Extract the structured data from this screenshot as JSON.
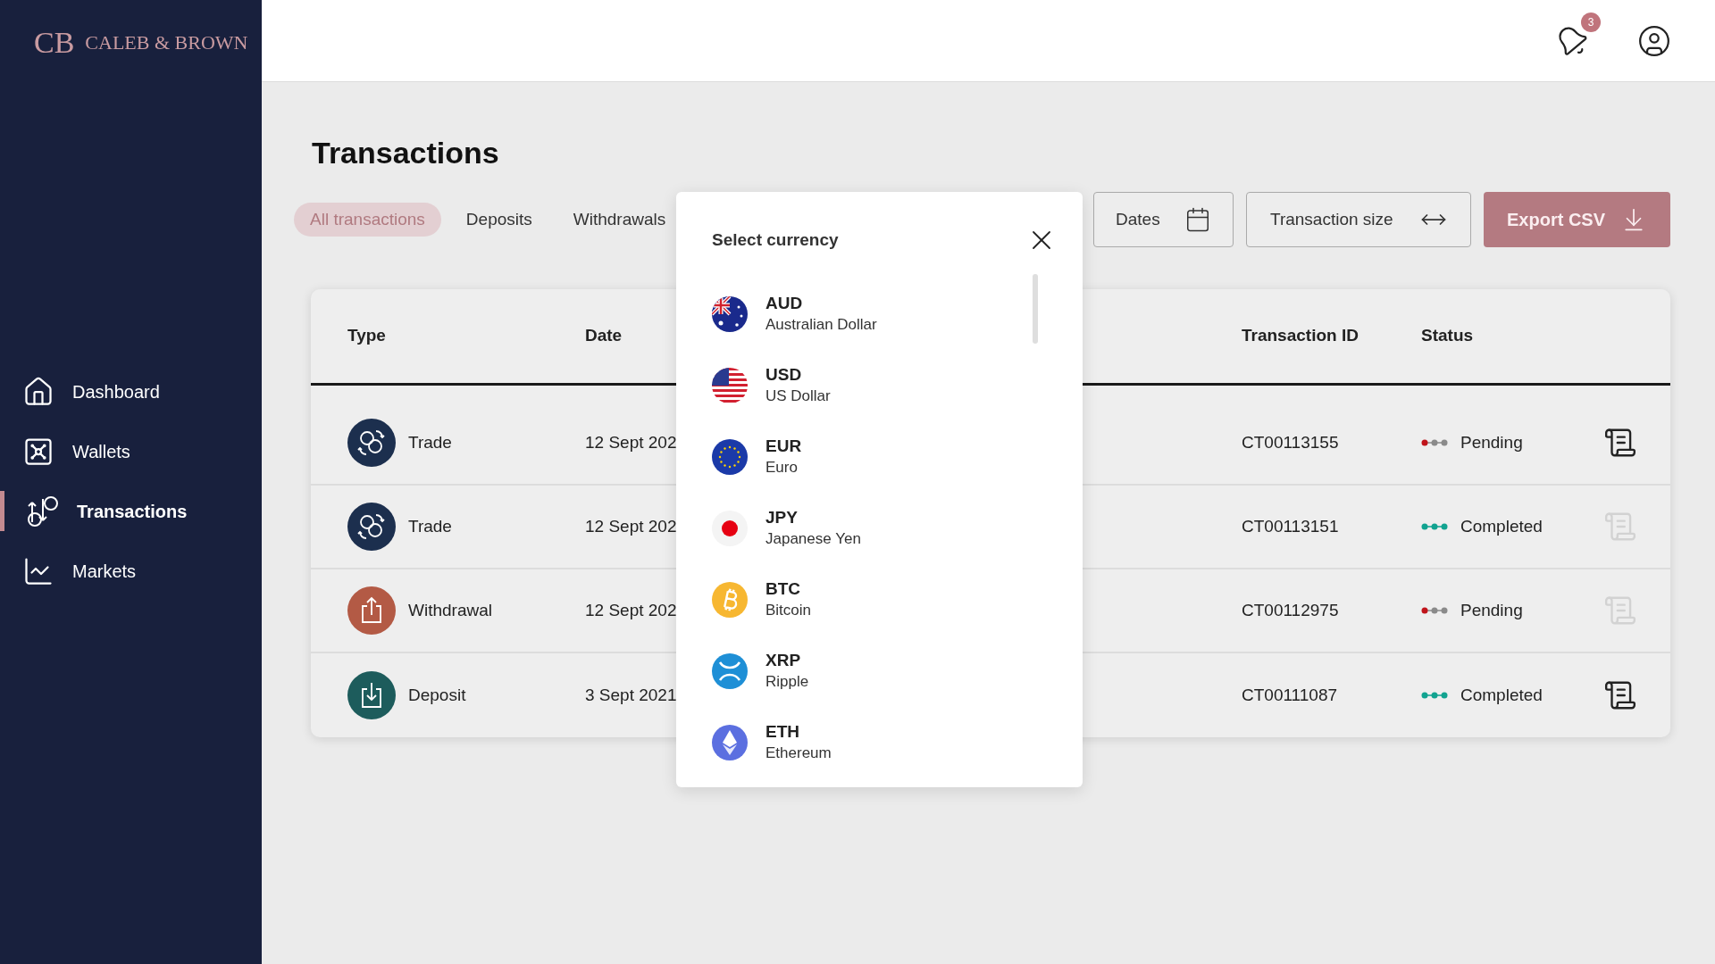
{
  "brand": {
    "monogram": "CB",
    "name": "CALEB & BROWN"
  },
  "sidebar": {
    "items": [
      {
        "label": "Dashboard",
        "selected": false
      },
      {
        "label": "Wallets",
        "selected": false
      },
      {
        "label": "Transactions",
        "selected": true
      },
      {
        "label": "Markets",
        "selected": false
      }
    ]
  },
  "header": {
    "notification_count": "3"
  },
  "page": {
    "title": "Transactions"
  },
  "tabs": [
    {
      "label": "All transactions",
      "selected": true
    },
    {
      "label": "Deposits",
      "selected": false
    },
    {
      "label": "Withdrawals",
      "selected": false
    }
  ],
  "filters": [
    {
      "label": "Dates",
      "kind": "dates"
    },
    {
      "label": "Transaction size",
      "kind": "range"
    }
  ],
  "export_button": {
    "label": "Export CSV"
  },
  "table": {
    "columns": [
      "Type",
      "Date",
      "Transaction ID",
      "Status"
    ],
    "rows": [
      {
        "kind": "trade",
        "type": "Trade",
        "date": "12 Sept 202",
        "transaction_id": "CT00113155",
        "status": "Pending",
        "completed": false,
        "receipt_available": true
      },
      {
        "kind": "trade",
        "type": "Trade",
        "date": "12 Sept 202",
        "transaction_id": "CT00113151",
        "status": "Completed",
        "completed": true,
        "receipt_available": false
      },
      {
        "kind": "withdrawal",
        "type": "Withdrawal",
        "date": "12 Sept 202",
        "transaction_id": "CT00112975",
        "status": "Pending",
        "completed": false,
        "receipt_available": false
      },
      {
        "kind": "deposit",
        "type": "Deposit",
        "date": "3 Sept 2021",
        "transaction_id": "CT00111087",
        "status": "Completed",
        "completed": true,
        "receipt_available": true
      }
    ]
  },
  "currency_popup": {
    "title": "Select currency",
    "items": [
      {
        "code": "AUD",
        "name": "Australian Dollar"
      },
      {
        "code": "USD",
        "name": "US Dollar"
      },
      {
        "code": "EUR",
        "name": "Euro"
      },
      {
        "code": "JPY",
        "name": "Japanese Yen"
      },
      {
        "code": "BTC",
        "name": "Bitcoin"
      },
      {
        "code": "XRP",
        "name": "Ripple"
      },
      {
        "code": "ETH",
        "name": "Ethereum"
      }
    ]
  }
}
